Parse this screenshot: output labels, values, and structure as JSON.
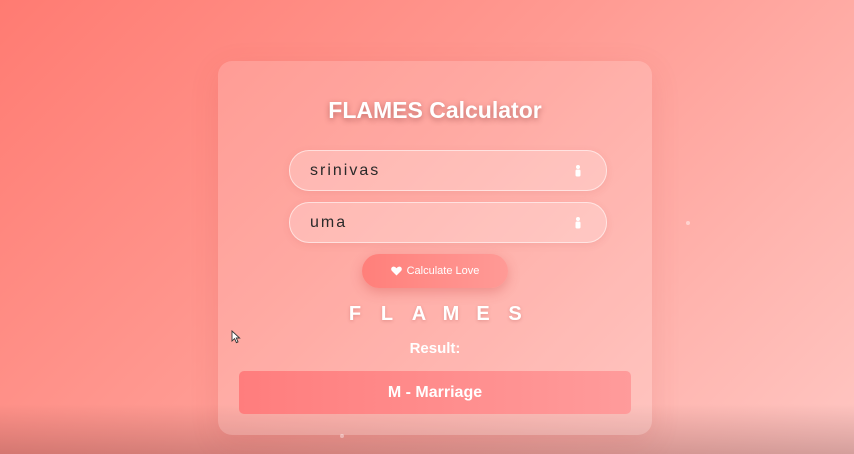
{
  "app": {
    "title": "FLAMES Calculator"
  },
  "form": {
    "name1_value": "srinivas",
    "name2_value": "uma",
    "person_icon": "person-icon",
    "calculate_icon": "heart-icon",
    "calculate_label": "Calculate Love"
  },
  "flames": {
    "letters": [
      "F",
      "L",
      "A",
      "M",
      "E",
      "S"
    ]
  },
  "result": {
    "label": "Result:",
    "value": "M - Marriage"
  },
  "colors": {
    "background_start": "#ff7b72",
    "background_end": "#ffc6c2",
    "button": "#ff8a86",
    "result_box": "#ff8585",
    "text": "#ffffff"
  }
}
